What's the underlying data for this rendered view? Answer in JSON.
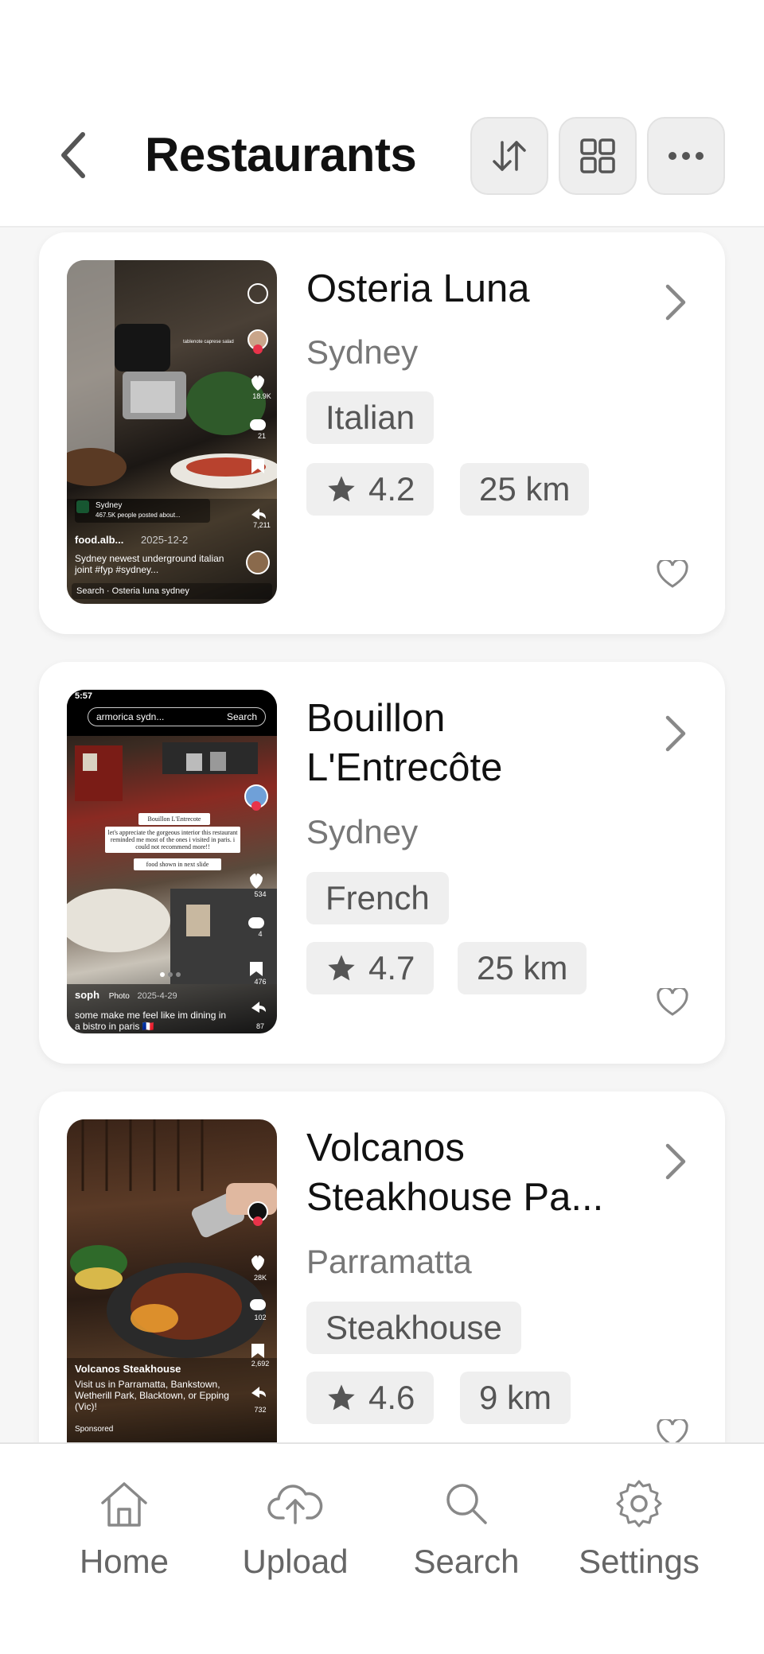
{
  "header": {
    "title": "Restaurants",
    "back_icon": "chevron-left-icon",
    "buttons": [
      {
        "name": "sort",
        "icon": "sort-arrows-icon"
      },
      {
        "name": "grid",
        "icon": "grid-icon"
      },
      {
        "name": "more",
        "icon": "more-dots-icon"
      }
    ]
  },
  "restaurants": [
    {
      "name": "Osteria Luna",
      "city": "Sydney",
      "cuisine": "Italian",
      "rating": "4.2",
      "distance": "25 km",
      "thumb": {
        "user": "food.alb...",
        "date": "2025-12-2",
        "location": "Sydney",
        "location_sub": "467.5K people posted about...",
        "caption": "Sydney newest underground italian joint #fyp #sydney...",
        "search": "Search · Osteria luna sydney",
        "tag": "tablenote caprese salad",
        "likes": "18.9K",
        "comments": "21",
        "shares": "7,211"
      }
    },
    {
      "name": "Bouillon\nL'Entrecôte",
      "city": "Sydney",
      "cuisine": "French",
      "rating": "4.7",
      "distance": "25 km",
      "thumb": {
        "status_time": "5:57",
        "search_query": "armorica sydn...",
        "search_label": "Search",
        "note_title": "Bouillon L'Entrecote",
        "note_body": "let's appreciate the gorgeous interior this restaurant reminded me most of the ones i visited in paris. i could not recommend more!!",
        "note_footer": "food shown in next slide",
        "user": "soph",
        "badge": "Photo",
        "date": "2025-4-29",
        "caption": "some make me feel like im dining in a bistro in paris 🇫🇷",
        "likes": "534",
        "comments": "4",
        "saves": "476",
        "shares": "87"
      }
    },
    {
      "name": "Volcanos\nSteakhouse Pa...",
      "city": "Parramatta",
      "cuisine": "Steakhouse",
      "rating": "4.6",
      "distance": "9 km",
      "thumb": {
        "user": "Volcanos Steakhouse",
        "caption": "Visit us in Parramatta, Bankstown, Wetherill Park, Blacktown, or Epping (Vic)!",
        "sponsored": "Sponsored",
        "likes": "28K",
        "comments": "102",
        "saves": "2,692",
        "shares": "732"
      }
    }
  ],
  "bottom_nav": [
    {
      "label": "Home",
      "icon": "home-icon"
    },
    {
      "label": "Upload",
      "icon": "cloud-upload-icon"
    },
    {
      "label": "Search",
      "icon": "search-icon"
    },
    {
      "label": "Settings",
      "icon": "gear-icon"
    }
  ],
  "colors": {
    "background": "#f6f6f6",
    "card": "#ffffff",
    "chip": "#efefef",
    "text_primary": "#111111",
    "text_secondary": "#777777",
    "icon": "#888888"
  }
}
